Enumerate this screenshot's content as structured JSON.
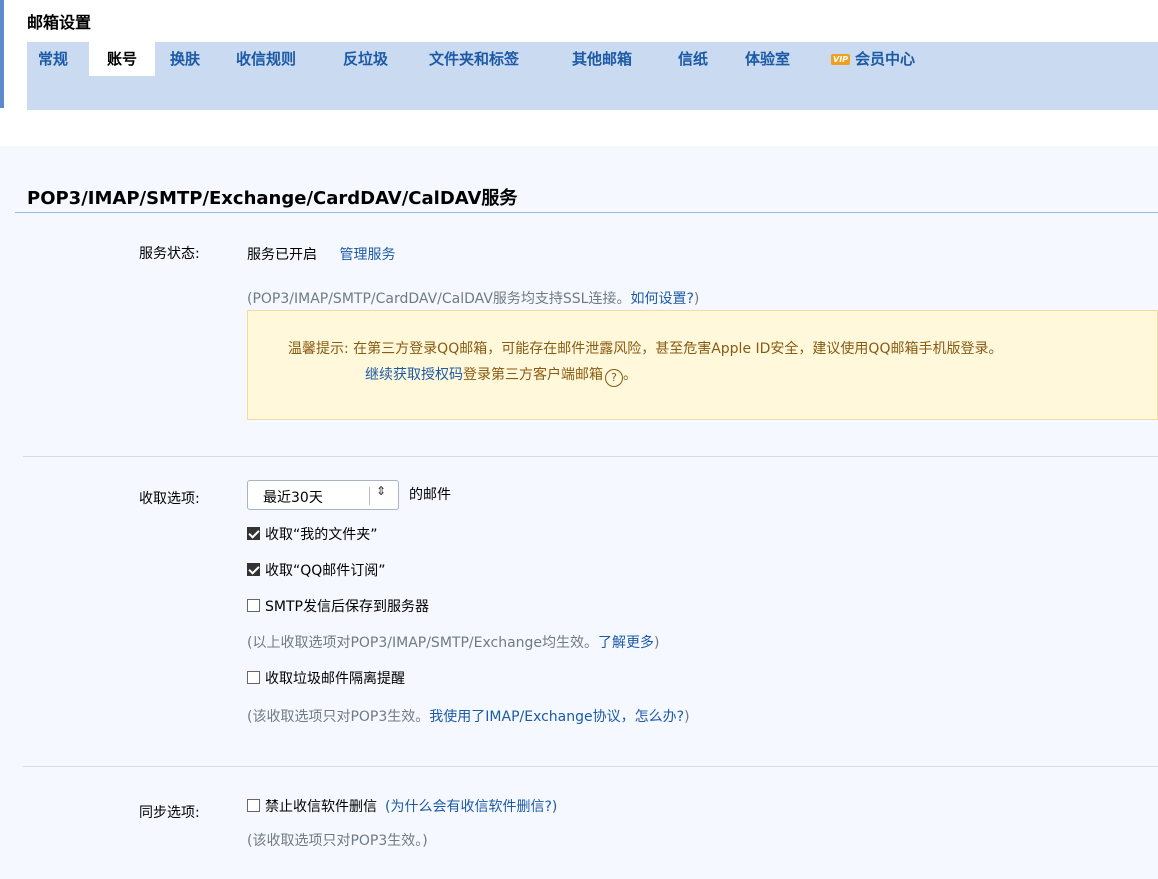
{
  "header": {
    "title": "邮箱设置"
  },
  "tabs": [
    {
      "label": "常规"
    },
    {
      "label": "账号"
    },
    {
      "label": "换肤"
    },
    {
      "label": "收信规则"
    },
    {
      "label": "反垃圾"
    },
    {
      "label": "文件夹和标签"
    },
    {
      "label": "其他邮箱"
    },
    {
      "label": "信纸"
    },
    {
      "label": "体验室"
    },
    {
      "label": "会员中心",
      "icon": "vip-icon",
      "icon_text": "VIP"
    }
  ],
  "active_tab": "账号",
  "section": {
    "title": "POP3/IMAP/SMTP/Exchange/CardDAV/CalDAV服务"
  },
  "service": {
    "label": "服务状态:",
    "status": "服务已开启",
    "manage_link": "管理服务",
    "ssl_note_prefix": "(POP3/IMAP/SMTP/CardDAV/CalDAV服务均支持SSL连接。",
    "ssl_note_link": "如何设置?",
    "ssl_note_suffix": ")",
    "tip_label": "温馨提示:",
    "tip_text": "在第三方登录QQ邮箱，可能存在邮件泄露风险，甚至危害Apple ID安全，建议使用QQ邮箱手机版登录。",
    "tip_link": "继续获取授权码",
    "tip_suffix": "登录第三方客户端邮箱",
    "tip_help_icon": "help-circle-icon",
    "tip_end": "。"
  },
  "fetch": {
    "label": "收取选项:",
    "range_value": "最近30天",
    "range_suffix": "的邮件",
    "options": [
      {
        "label": "收取“我的文件夹”",
        "checked": true
      },
      {
        "label": "收取“QQ邮件订阅”",
        "checked": true
      },
      {
        "label": "SMTP发信后保存到服务器",
        "checked": false
      }
    ],
    "note1_prefix": "(以上收取选项对POP3/IMAP/SMTP/Exchange均生效。",
    "note1_link": "了解更多",
    "note1_suffix": ")",
    "spam_option": {
      "label": "收取垃圾邮件隔离提醒",
      "checked": false
    },
    "note2_prefix": "(该收取选项只对POP3生效。",
    "note2_link": "我使用了IMAP/Exchange协议，怎么办?",
    "note2_suffix": ")"
  },
  "sync": {
    "label": "同步选项:",
    "option": {
      "label": "禁止收信软件删信",
      "checked": false
    },
    "why_link": "(为什么会有收信软件删信?)",
    "note": "(该收取选项只对POP3生效。)"
  },
  "colors": {
    "accent": "#1d5aa6",
    "tabbar": "#c9daf1",
    "notice_bg": "#fff8db",
    "content_bg": "#f5f9ff"
  }
}
